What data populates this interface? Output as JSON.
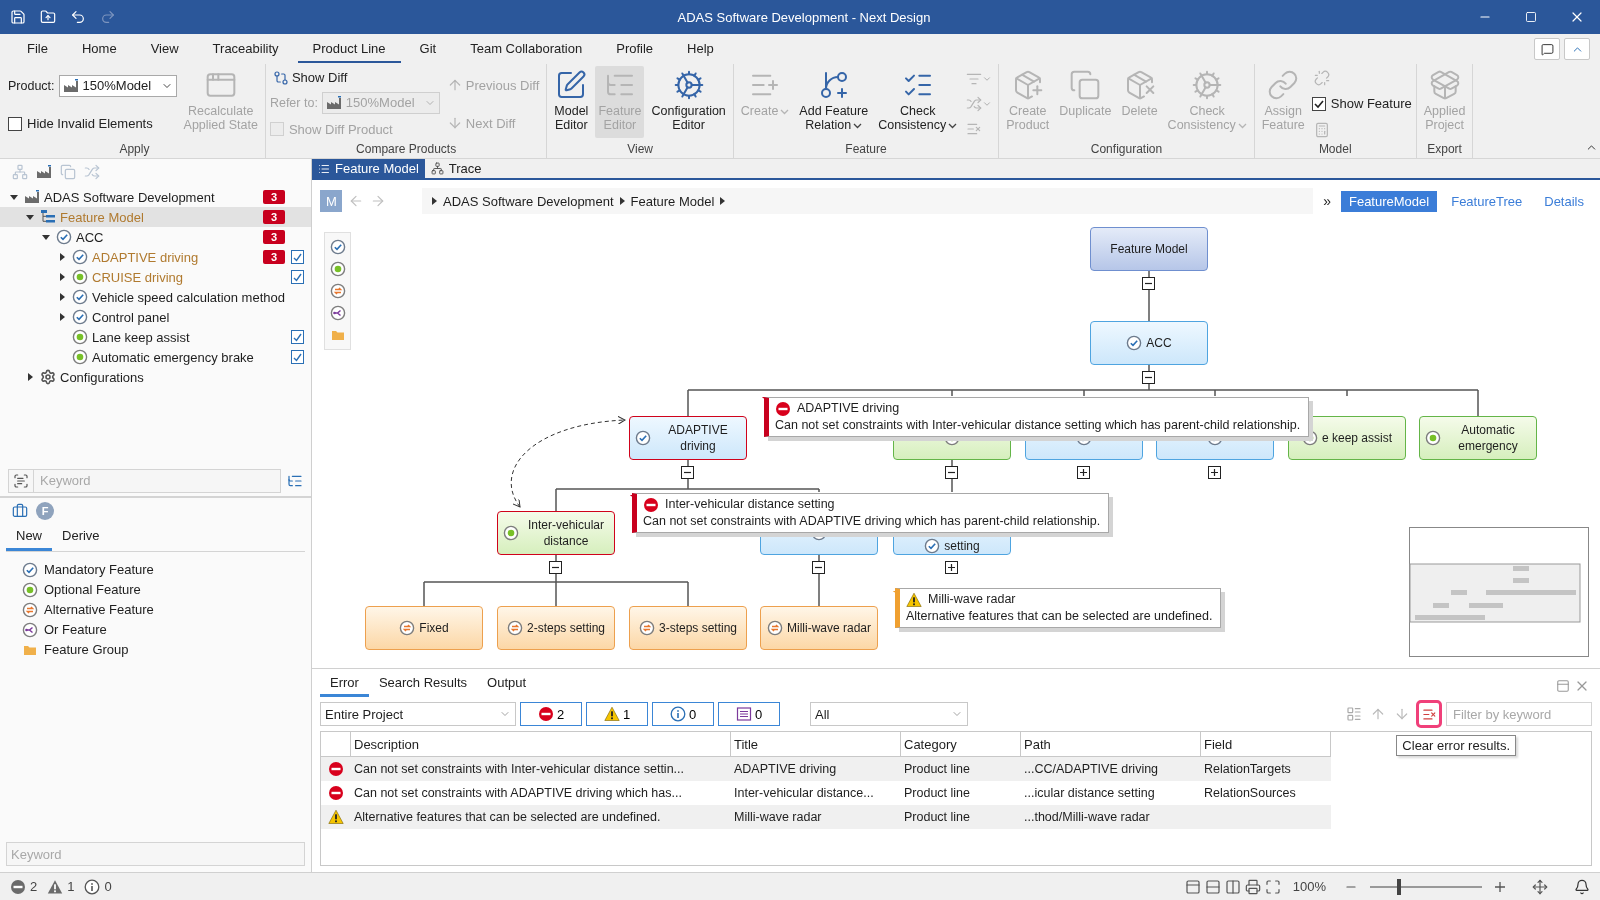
{
  "window": {
    "title": "ADAS Software Development - Next Design"
  },
  "menu": [
    {
      "label": "File",
      "selected": false
    },
    {
      "label": "Home",
      "selected": false
    },
    {
      "label": "View",
      "selected": false
    },
    {
      "label": "Traceability",
      "selected": false
    },
    {
      "label": "Product Line",
      "selected": true
    },
    {
      "label": "Git",
      "selected": false
    },
    {
      "label": "Team Collaboration",
      "selected": false
    },
    {
      "label": "Profile",
      "selected": false
    },
    {
      "label": "Help",
      "selected": false
    }
  ],
  "ribbon": [
    {
      "label": "Apply",
      "columns": [
        [
          {
            "kind": "combo",
            "label": "Product:",
            "value": "150%Model",
            "disabled": false
          },
          {
            "kind": "checkbox",
            "label": "Hide Invalid Elements",
            "checked": false,
            "disabled": false
          }
        ],
        [
          {
            "kind": "large",
            "label": "Recalculate\nApplied State",
            "disabled": true,
            "dropdown": false
          }
        ]
      ]
    },
    {
      "label": "Compare Products",
      "columns": [
        [
          {
            "kind": "small",
            "label": "Show Diff",
            "disabled": false
          },
          {
            "kind": "combo",
            "label": "Refer to:",
            "value": "150%Model",
            "disabled": true
          },
          {
            "kind": "checkbox",
            "label": "Show Diff Product",
            "checked": false,
            "disabled": true
          }
        ],
        [
          {
            "kind": "small",
            "label": "Previous Diff",
            "disabled": true
          },
          {
            "kind": "small",
            "label": "Next Diff",
            "disabled": true
          }
        ]
      ]
    },
    {
      "label": "View",
      "columns": [
        [
          {
            "kind": "large",
            "label": "Model\nEditor",
            "disabled": false,
            "dropdown": false,
            "selected": false
          }
        ],
        [
          {
            "kind": "large",
            "label": "Feature\nEditor",
            "disabled": true,
            "dropdown": false,
            "selected": true
          }
        ],
        [
          {
            "kind": "large",
            "label": "Configuration\nEditor",
            "disabled": false,
            "dropdown": false,
            "selected": false
          }
        ]
      ]
    },
    {
      "label": "Feature",
      "columns": [
        [
          {
            "kind": "large",
            "label": "Create",
            "disabled": true,
            "dropdown": true
          }
        ],
        [
          {
            "kind": "large",
            "label": "Add Feature\nRelation",
            "disabled": false,
            "dropdown": true
          }
        ],
        [
          {
            "kind": "large",
            "label": "Check\nConsistency",
            "disabled": false,
            "dropdown": true
          }
        ],
        [
          {
            "kind": "icon",
            "disabled": true,
            "dropdown": true
          },
          {
            "kind": "icon",
            "disabled": true,
            "dropdown": true
          },
          {
            "kind": "icon",
            "disabled": true,
            "dropdown": false
          }
        ]
      ]
    },
    {
      "label": "Configuration",
      "columns": [
        [
          {
            "kind": "large",
            "label": "Create\nProduct",
            "disabled": true,
            "dropdown": false
          }
        ],
        [
          {
            "kind": "large",
            "label": "Duplicate",
            "disabled": true,
            "dropdown": false
          }
        ],
        [
          {
            "kind": "large",
            "label": "Delete",
            "disabled": true,
            "dropdown": false
          }
        ],
        [
          {
            "kind": "large",
            "label": "Check\nConsistency",
            "disabled": true,
            "dropdown": true
          }
        ]
      ]
    },
    {
      "label": "Model",
      "columns": [
        [
          {
            "kind": "large",
            "label": "Assign\nFeature",
            "disabled": true,
            "dropdown": false
          }
        ],
        [
          {
            "kind": "icon",
            "disabled": true,
            "dropdown": false
          },
          {
            "kind": "checkbox",
            "label": "Show Feature",
            "checked": true,
            "disabled": false
          },
          {
            "kind": "icon",
            "disabled": true,
            "dropdown": false
          }
        ]
      ]
    },
    {
      "label": "Export",
      "columns": [
        [
          {
            "kind": "large",
            "label": "Applied\nProject",
            "disabled": true,
            "dropdown": false
          }
        ]
      ]
    }
  ],
  "tree": [
    {
      "label": "ADAS Software Development",
      "kind": "project",
      "badge": "3",
      "expanded": true,
      "selected": false,
      "flagged": false,
      "note": false,
      "children": [
        {
          "label": "Feature Model",
          "kind": "model",
          "badge": "3",
          "expanded": true,
          "selected": true,
          "flagged": true,
          "note": false,
          "children": [
            {
              "label": "ACC",
              "kind": "mandatory",
              "badge": "3",
              "expanded": true,
              "selected": false,
              "flagged": false,
              "note": false,
              "children": [
                {
                  "label": "ADAPTIVE driving",
                  "kind": "mandatory",
                  "badge": "3",
                  "expanded": false,
                  "selected": false,
                  "flagged": true,
                  "note": true
                },
                {
                  "label": "CRUISE driving",
                  "kind": "optional",
                  "expanded": false,
                  "selected": false,
                  "flagged": true,
                  "note": true
                },
                {
                  "label": "Vehicle speed calculation method",
                  "kind": "mandatory",
                  "expanded": false,
                  "selected": false,
                  "flagged": false,
                  "note": false
                },
                {
                  "label": "Control panel",
                  "kind": "mandatory",
                  "expanded": false,
                  "selected": false,
                  "flagged": false,
                  "note": false
                },
                {
                  "label": "Lane keep assist",
                  "kind": "optional",
                  "selected": false,
                  "flagged": false,
                  "note": true
                },
                {
                  "label": "Automatic emergency brake",
                  "kind": "optional",
                  "selected": false,
                  "flagged": false,
                  "note": true
                }
              ]
            }
          ]
        },
        {
          "label": "Configurations",
          "kind": "configurations",
          "expanded": false,
          "selected": false,
          "flagged": false,
          "note": false
        }
      ]
    }
  ],
  "tree_search": {
    "placeholder": "Keyword"
  },
  "toolbox": {
    "letter": "F",
    "tabs": [
      {
        "label": "New",
        "selected": true
      },
      {
        "label": "Derive",
        "selected": false
      }
    ],
    "items": [
      {
        "label": "Mandatory Feature",
        "kind": "mandatory"
      },
      {
        "label": "Optional Feature",
        "kind": "optional"
      },
      {
        "label": "Alternative Feature",
        "kind": "alternative"
      },
      {
        "label": "Or Feature",
        "kind": "or"
      },
      {
        "label": "Feature Group",
        "kind": "group"
      }
    ],
    "search": {
      "placeholder": "Keyword"
    }
  },
  "doc_tabs": [
    {
      "label": "Feature Model",
      "selected": true
    },
    {
      "label": "Trace",
      "selected": false
    }
  ],
  "breadcrumb": {
    "button": "M",
    "items": [
      "ADAS Software Development",
      "Feature Model"
    ],
    "overflow": "»"
  },
  "view_tabs": [
    {
      "label": "FeatureModel",
      "selected": true
    },
    {
      "label": "FeatureTree",
      "selected": false
    },
    {
      "label": "Details",
      "selected": false
    }
  ],
  "nodes": [
    {
      "kind": "root",
      "label": "Feature Model",
      "error": false,
      "expanded": true
    },
    {
      "kind": "mandatory",
      "label": "ACC",
      "error": false,
      "expanded": true
    },
    {
      "kind": "mandatory",
      "label": "ADAPTIVE driving",
      "error": true,
      "expanded": true
    },
    {
      "kind": "optional",
      "error": false,
      "expanded": true
    },
    {
      "kind": "mandatory",
      "error": false,
      "expanded": false
    },
    {
      "kind": "mandatory",
      "error": false,
      "expanded": false
    },
    {
      "kind": "optional",
      "label": "e keep assist",
      "error": false
    },
    {
      "kind": "optional",
      "label": "Automatic emergency",
      "error": false
    },
    {
      "kind": "optional",
      "label": "Inter-vehicular distance",
      "error": true,
      "expanded": true
    },
    {
      "kind": "mandatory",
      "error": false,
      "expanded": true
    },
    {
      "kind": "mandatory",
      "label": "setting",
      "error": false,
      "expanded": false
    },
    {
      "kind": "alternative",
      "label": "Fixed",
      "error": false
    },
    {
      "kind": "alternative",
      "label": "2-steps setting",
      "error": false
    },
    {
      "kind": "alternative",
      "label": "3-steps setting",
      "error": false
    },
    {
      "kind": "alternative",
      "label": "Milli-wave radar",
      "error": false
    }
  ],
  "callouts": [
    {
      "kind": "error",
      "title": "ADAPTIVE driving",
      "message": "Can not set constraints with Inter-vehicular distance setting which has parent-child relationship."
    },
    {
      "kind": "error",
      "title": "Inter-vehicular distance setting",
      "message": "Can not set constraints with ADAPTIVE driving which has parent-child relationship."
    },
    {
      "kind": "warning",
      "title": "Milli-wave radar",
      "message": "Alternative features that can be selected are undefined."
    }
  ],
  "results": {
    "tabs": [
      {
        "label": "Error",
        "selected": true
      },
      {
        "label": "Search Results",
        "selected": false
      },
      {
        "label": "Output",
        "selected": false
      }
    ],
    "scope": "Entire Project",
    "filters": [
      {
        "kind": "error",
        "count": "2",
        "on": true
      },
      {
        "kind": "warning",
        "count": "1",
        "on": true
      },
      {
        "kind": "info",
        "count": "0",
        "on": true
      },
      {
        "kind": "message",
        "count": "0",
        "on": true
      }
    ],
    "category": "All",
    "clear_button": {
      "highlighted": true,
      "tooltip": "Clear error results."
    },
    "filter_field": {
      "placeholder": "Filter by keyword"
    },
    "columns": [
      "Description",
      "Title",
      "Category",
      "Path",
      "Field"
    ],
    "rows": [
      {
        "kind": "error",
        "cells": [
          "Can not set constraints with Inter-vehicular distance settin...",
          "ADAPTIVE driving",
          "Product line",
          "...CC/ADAPTIVE driving",
          "RelationTargets"
        ]
      },
      {
        "kind": "error",
        "cells": [
          "Can not set constraints with ADAPTIVE driving which has...",
          "Inter-vehicular distance...",
          "Product line",
          "...icular distance setting",
          "RelationSources"
        ]
      },
      {
        "kind": "warning",
        "cells": [
          "Alternative features that can be selected are undefined.",
          "Milli-wave radar",
          "Product line",
          "...thod/Milli-wave radar"
        ]
      }
    ]
  },
  "status_bar": {
    "errors": "2",
    "warnings": "1",
    "infos": "0",
    "zoom": "100%",
    "level": 0.25
  }
}
